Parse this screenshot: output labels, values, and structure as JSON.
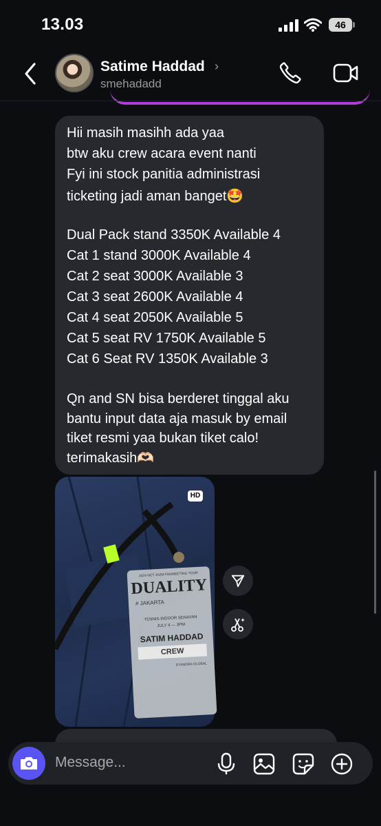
{
  "status_bar": {
    "time": "13.03",
    "battery": "46"
  },
  "header": {
    "contact_name": "Satime Haddad",
    "contact_handle": "smehadadd",
    "chevron": "›"
  },
  "message": {
    "lines": [
      "Hii masih masihh ada yaa",
      "btw aku crew acara event nanti",
      "Fyi ini stock panitia administrasi",
      "ticketing jadi aman banget🤩",
      "Dual Pack stand 3350K Available 4",
      "Cat 1 stand 3000K Available 4",
      "Cat 2 seat 3000K Available 3",
      "Cat 3 seat 2600K Available 4",
      "Cat 4 seat 2050K Available 5",
      "Cat 5 seat RV 1750K Available 5",
      "Cat 6 Seat RV 1350K Available 3",
      "Qn and SN bisa berderet tinggal aku",
      "bantu input data aja masuk by email",
      "tiket resmi yaa bukan tiket calo!",
      "terimakasih🫶🏻"
    ]
  },
  "photo": {
    "hd_badge": "HD",
    "card": {
      "tour_line": "2024 NCT JNJM FANMEETING TOUR",
      "title": "DUALITY",
      "city": "# JAKARTA",
      "venue": "TENNIS INDOOR SENAYAN",
      "date": "JULY 4 — 3PM",
      "holder": "SATIM HADDAD",
      "role": "CREW",
      "org": "DYANDRA GLOBAL"
    }
  },
  "composer": {
    "placeholder": "Message..."
  },
  "icons": {
    "back": "chevron-left-icon",
    "call": "phone-icon",
    "video": "video-camera-icon",
    "camera": "camera-icon",
    "mic": "microphone-icon",
    "gallery": "image-icon",
    "sticker": "sticker-icon",
    "add": "plus-circle-icon",
    "share": "send-icon",
    "remix": "remix-icon"
  },
  "colors": {
    "background": "#0b0d10",
    "bubble": "#262a2e",
    "accent": "#5b54f5",
    "previous_bubble_edge": "#b03ed6"
  }
}
